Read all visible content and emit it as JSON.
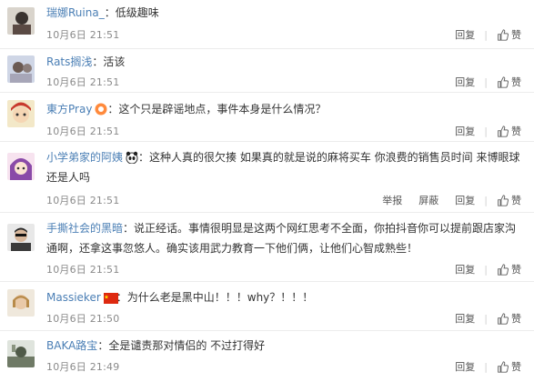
{
  "actions": {
    "report": "举报",
    "block": "屏蔽",
    "reply": "回复",
    "like": "赞"
  },
  "comments": [
    {
      "user": "瑞娜Ruina_",
      "content": "：低级趣味",
      "time": "10月6日 21:51"
    },
    {
      "user": "Rats搁浅",
      "content": "：活该",
      "time": "10月6日 21:51"
    },
    {
      "user": "東方Pray",
      "content": "：这个只是辟谣地点，事件本身是什么情况？",
      "time": "10月6日 21:51"
    },
    {
      "user": "小学弟家的阿姨",
      "content": "：这种人真的很欠揍 如果真的就是说的麻将买车 你浪费的销售员时间 来博眼球还是人吗",
      "time": "10月6日 21:51"
    },
    {
      "user": "手撕社会的黑暗",
      "content": "：说正经话。事情很明显是这两个网红思考不全面，你拍抖音你可以提前跟店家沟通啊，还拿这事忽悠人。确实该用武力教育一下他们俩，让他们心智成熟些！",
      "time": "10月6日 21:51"
    },
    {
      "user": "Massieker",
      "content": "：为什么老是黑中山！！！why？！！！",
      "time": "10月6日 21:50"
    },
    {
      "user": "BAKA路宝",
      "content": "：全是谴责那对情侣的 不过打得好",
      "time": "10月6日 21:49"
    }
  ]
}
